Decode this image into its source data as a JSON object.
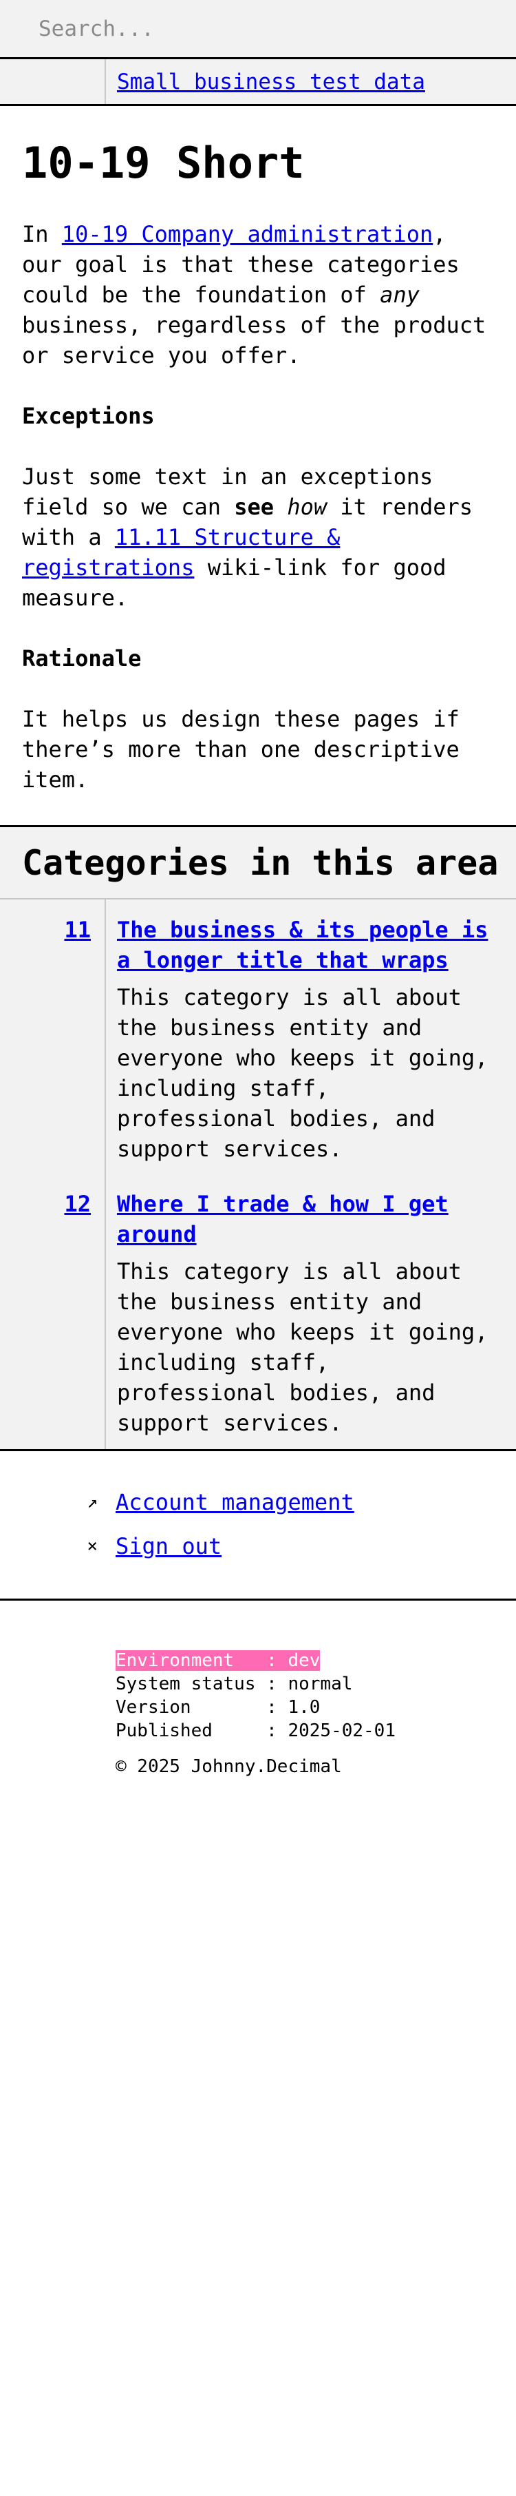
{
  "search": {
    "placeholder": "Search..."
  },
  "breadcrumb": {
    "link": "Small business test data"
  },
  "page": {
    "title": "10-19 Short",
    "intro_prefix": "In ",
    "intro_link": "10-19 Company administration",
    "intro_mid": ", our goal is that these categories could be the foundation of ",
    "intro_em": "any",
    "intro_suffix": " business, regardless of the product or service you offer.",
    "exceptions_heading": "Exceptions",
    "exceptions_prefix": "Just some text in an exceptions field so we can ",
    "exceptions_strong": "see",
    "exceptions_space": " ",
    "exceptions_em": "how",
    "exceptions_mid": " it renders with a ",
    "exceptions_link": "11.11 Structure & registrations",
    "exceptions_suffix": " wiki-link for good measure.",
    "rationale_heading": "Rationale",
    "rationale_text": "It helps us design these pages if there’s more than one descriptive item."
  },
  "categories": {
    "heading": "Categories in this area",
    "items": [
      {
        "number": "11",
        "title": "The business & its people is a longer title that wraps",
        "description": "This category is all about the business entity and everyone who keeps it going, including staff, professional bodies, and support services."
      },
      {
        "number": "12",
        "title": "Where I trade & how I get around",
        "description": "This category is all about the business entity and everyone who keeps it going, including staff, professional bodies, and support services."
      }
    ]
  },
  "account_nav": {
    "items": [
      {
        "icon": "arrow-up-right-icon",
        "glyph": "↗",
        "label": "Account management"
      },
      {
        "icon": "close-icon",
        "glyph": "×",
        "label": "Sign out"
      }
    ]
  },
  "footer": {
    "environment": "Environment   : dev",
    "system_status": "System status : normal",
    "version": "Version       : 1.0",
    "published": "Published     : 2025-02-01",
    "copyright": "© 2025 Johnny.Decimal"
  },
  "colors": {
    "link": "#0000ee",
    "panel_bg": "#f2f2f2",
    "env_highlight": "#ff6ab4"
  }
}
